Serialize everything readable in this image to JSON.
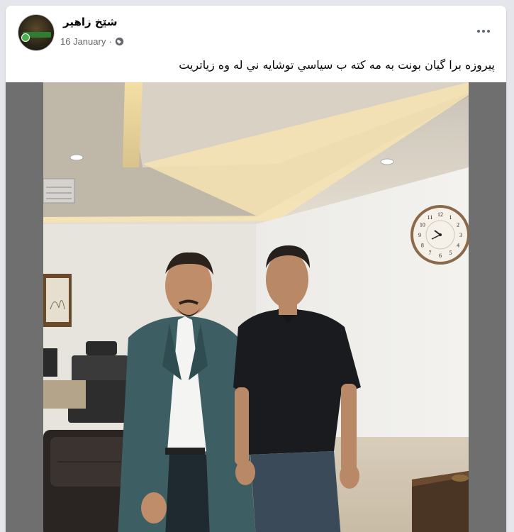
{
  "post": {
    "author": "شێخ زاهیر",
    "date": "16 January",
    "separator": "·",
    "privacy_icon": "globe-icon",
    "more_icon": "more-options-icon",
    "caption": "پیروزه برا گیان بونت به مه كته ب سیاسي توشايه ني له وه زياتريت"
  },
  "photo": {
    "clock_numbers": [
      "12",
      "1",
      "2",
      "3",
      "4",
      "5",
      "6",
      "7",
      "8",
      "9",
      "10",
      "11"
    ]
  },
  "colors": {
    "background": "#e4e6eb",
    "card": "#ffffff",
    "text": "#050505",
    "meta_text": "#65676b"
  }
}
